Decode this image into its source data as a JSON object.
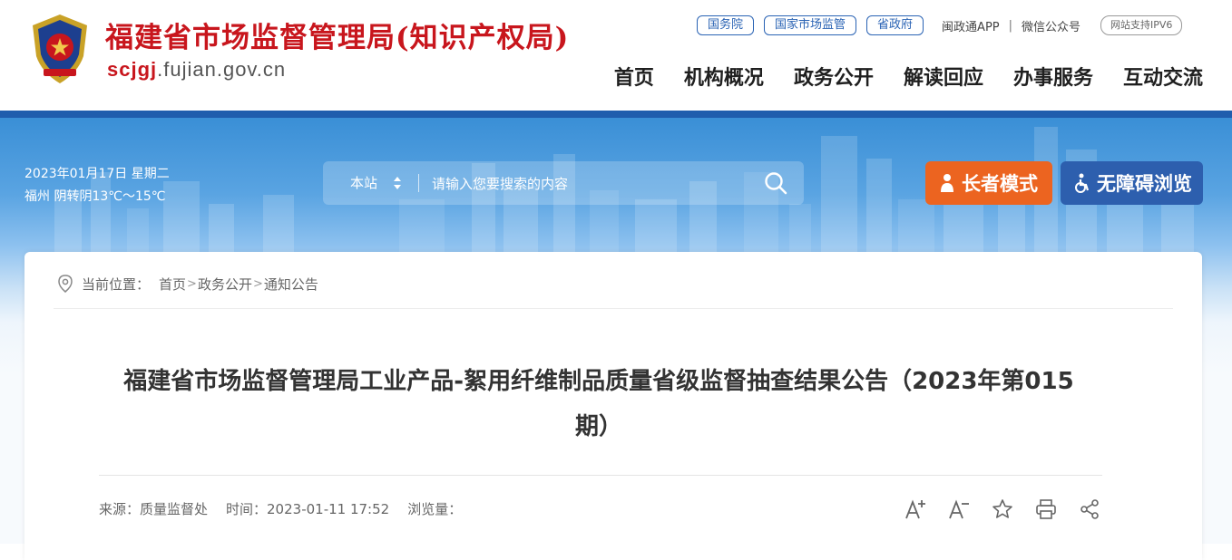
{
  "header": {
    "site_name": "福建省市场监督管理局(知识产权局)",
    "domain_strong": "scjgj",
    "domain_rest": ".fujian.gov.cn",
    "top_links": [
      "国务院",
      "国家市场监管",
      "省政府"
    ],
    "app_link": "闽政通APP",
    "wechat_link": "微信公众号",
    "ipv6_badge": "网站支持IPV6",
    "nav": [
      "首页",
      "机构概况",
      "政务公开",
      "解读回应",
      "办事服务",
      "互动交流"
    ]
  },
  "banner": {
    "date": "2023年01月17日 星期二",
    "weather": "福州 阴转阴13℃～15℃",
    "search": {
      "scope": "本站",
      "placeholder": "请输入您要搜索的内容"
    },
    "elder_mode": "长者模式",
    "accessible": "无障碍浏览"
  },
  "breadcrumb": {
    "label": "当前位置：",
    "items": [
      "首页",
      "政务公开",
      "通知公告"
    ]
  },
  "article": {
    "title": "福建省市场监督管理局工业产品-絮用纤维制品质量省级监督抽查结果公告（2023年第015期）",
    "source": "来源：质量监督处",
    "time": "时间：2023-01-11 17:52",
    "views": "浏览量："
  },
  "colors": {
    "brand_red": "#c8161d",
    "nav_blue": "#2a63b4",
    "elder_orange": "#ec6420",
    "accessible_blue": "#2d5fae"
  },
  "icons": [
    "emblem-icon",
    "chevron-updown-icon",
    "search-icon",
    "elder-person-icon",
    "wheelchair-icon",
    "location-pin-icon",
    "font-increase-icon",
    "font-decrease-icon",
    "star-icon",
    "print-icon",
    "share-icon"
  ]
}
